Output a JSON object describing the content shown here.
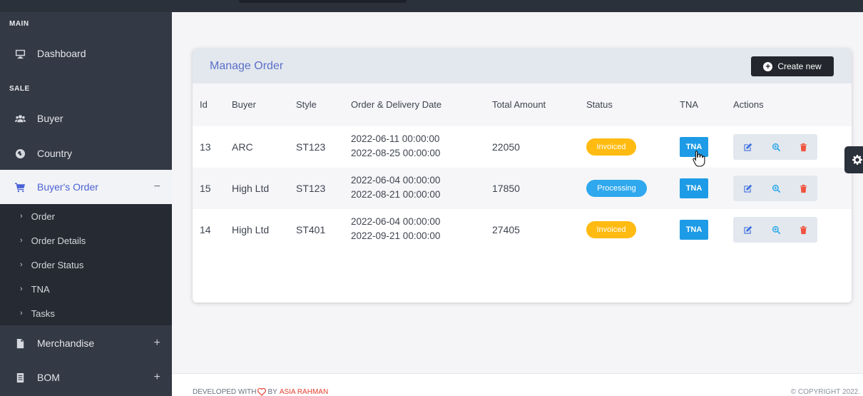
{
  "sidebar": {
    "section_main": "MAIN",
    "section_sale": "SALE",
    "items": {
      "dashboard": "Dashboard",
      "buyer": "Buyer",
      "country": "Country",
      "buyers_order": "Buyer's Order",
      "merchandise": "Merchandise",
      "bom": "BOM"
    },
    "buyers_order_toggle": "−",
    "merchandise_toggle": "+",
    "bom_toggle": "+",
    "submenu": [
      "Order",
      "Order Details",
      "Order Status",
      "TNA",
      "Tasks"
    ]
  },
  "card": {
    "title": "Manage Order",
    "create_label": "Create new",
    "columns": [
      "Id",
      "Buyer",
      "Style",
      "Order & Delivery Date",
      "Total Amount",
      "Status",
      "TNA",
      "Actions"
    ],
    "rows": [
      {
        "id": "13",
        "buyer": "ARC",
        "style": "ST123",
        "order_date": "2022-06-11 00:00:00",
        "delivery_date": "2022-08-25 00:00:00",
        "amount": "22050",
        "status": "Invoiced",
        "tna": "TNA"
      },
      {
        "id": "15",
        "buyer": "High Ltd",
        "style": "ST123",
        "order_date": "2022-06-04 00:00:00",
        "delivery_date": "2022-08-21 00:00:00",
        "amount": "17850",
        "status": "Processing",
        "tna": "TNA"
      },
      {
        "id": "14",
        "buyer": "High Ltd",
        "style": "ST401",
        "order_date": "2022-06-04 00:00:00",
        "delivery_date": "2022-09-21 00:00:00",
        "amount": "27405",
        "status": "Invoiced",
        "tna": "TNA"
      }
    ]
  },
  "footer": {
    "developed_with": "DEVELOPED WITH",
    "by": "BY",
    "author": "ASIA RAHMAN",
    "copyright": "© COPYRIGHT 2022."
  },
  "colors": {
    "accent": "#4b63d6",
    "invoiced": "#ffbb12",
    "processing": "#2fa8ee",
    "tna": "#1e9be6"
  }
}
